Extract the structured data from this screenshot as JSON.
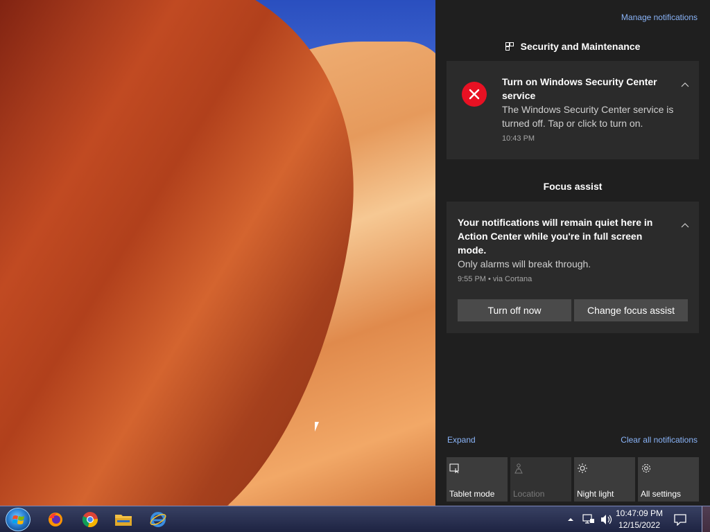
{
  "action_center": {
    "manage_notifications": "Manage notifications",
    "groups": [
      {
        "header": "Security and Maintenance",
        "notification": {
          "title": "Turn on Windows Security Center service",
          "body": "The Windows Security Center service is turned off. Tap or click to turn on.",
          "time": "10:43 PM"
        }
      },
      {
        "header": "Focus assist",
        "notification": {
          "title": "Your notifications will remain quiet here in Action Center while you're in full screen mode.",
          "body": "Only alarms will break through.",
          "time": "9:55 PM • via Cortana",
          "buttons": [
            "Turn off now",
            "Change focus assist"
          ]
        }
      }
    ],
    "expand": "Expand",
    "clear_all": "Clear all notifications",
    "quick_actions": [
      {
        "label": "Tablet mode",
        "icon": "tablet-mode-icon",
        "enabled": true
      },
      {
        "label": "Location",
        "icon": "location-icon",
        "enabled": false
      },
      {
        "label": "Night light",
        "icon": "night-light-icon",
        "enabled": true
      },
      {
        "label": "All settings",
        "icon": "settings-icon",
        "enabled": true
      }
    ]
  },
  "taskbar": {
    "apps": [
      "firefox-icon",
      "chrome-icon",
      "file-explorer-icon",
      "internet-explorer-icon"
    ],
    "tray_icons": [
      "show-hidden-icons-icon",
      "network-icon",
      "volume-icon"
    ],
    "time": "10:47:09 PM",
    "date": "12/15/2022"
  },
  "colors": {
    "panel_bg": "#1f1f1f",
    "toast_bg": "#2b2b2b",
    "link": "#8ab4f8",
    "error": "#e81123",
    "button_bg": "#4a4a4a"
  }
}
